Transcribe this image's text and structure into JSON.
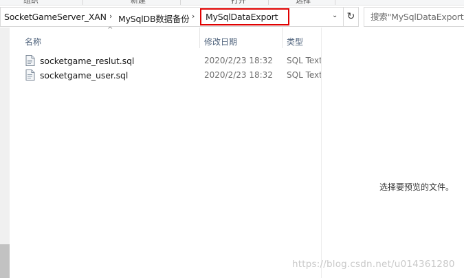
{
  "ribbon": {
    "groups": [
      "组织",
      "新建",
      "打开",
      "选择"
    ]
  },
  "address_bar": {
    "breadcrumbs": [
      "SocketGameServer_XAN",
      "MySqlDB数据备份"
    ],
    "current_folder": "MySqlDataExport",
    "separator_glyph": "›",
    "dropdown_glyph": "⌄",
    "refresh_glyph": "↻"
  },
  "search": {
    "placeholder": "搜索\"MySqlDataExport\""
  },
  "columns": {
    "name": "名称",
    "date_modified": "修改日期",
    "type": "类型"
  },
  "files": [
    {
      "name": "socketgame_reslut.sql",
      "date": "2020/2/23 18:32",
      "type": "SQL Text"
    },
    {
      "name": "socketgame_user.sql",
      "date": "2020/2/23 18:32",
      "type": "SQL Text"
    }
  ],
  "preview": {
    "message": "选择要预览的文件。"
  },
  "watermark": "https://blog.csdn.net/u014361280",
  "colors": {
    "highlight_border": "#e00000",
    "header_text": "#4c607a"
  },
  "icons": {
    "file": "sql-file-icon",
    "refresh": "refresh-icon",
    "dropdown": "chevron-down-icon",
    "sort": "sort-up-icon"
  }
}
